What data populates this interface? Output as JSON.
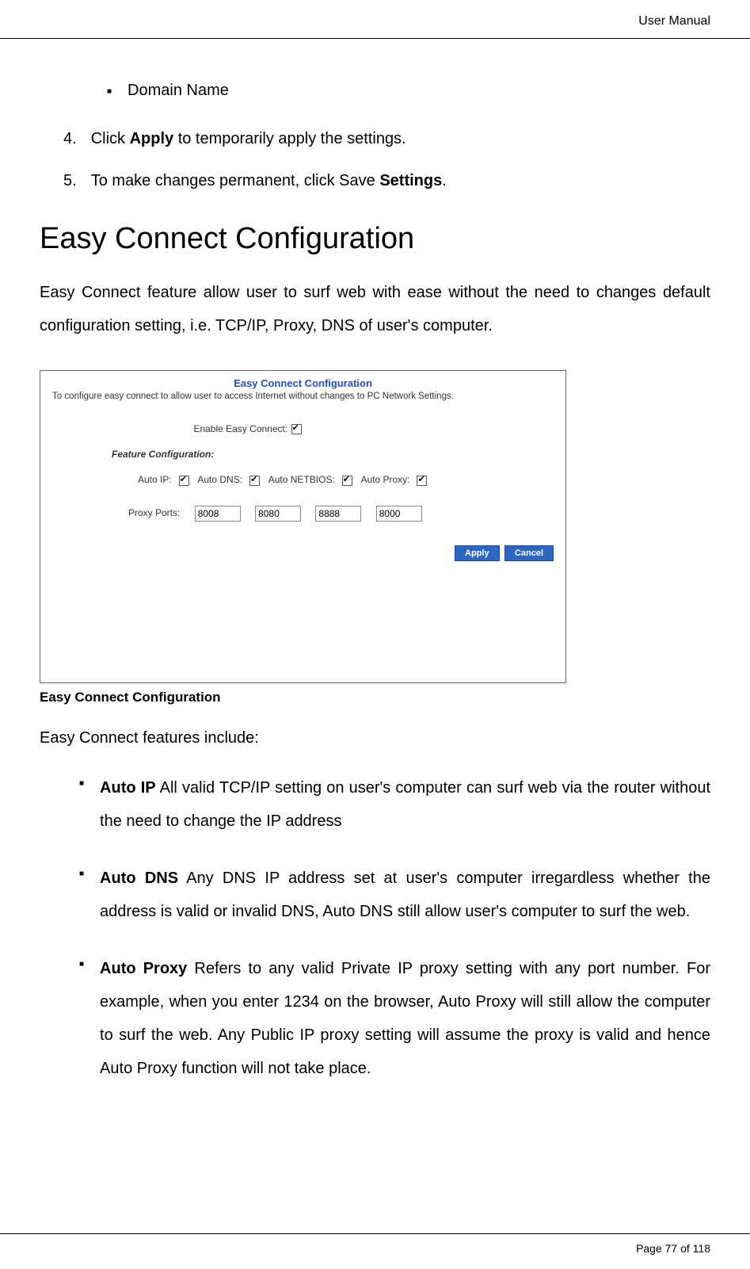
{
  "header": {
    "title": "User Manual"
  },
  "bullet1": {
    "text": "Domain Name"
  },
  "step4": {
    "num": "4.",
    "prefix": "Click ",
    "bold": "Apply",
    "suffix": " to temporarily apply the settings."
  },
  "step5": {
    "num": "5.",
    "prefix": "To make changes permanent, click Save ",
    "bold": "Settings",
    "suffix": "."
  },
  "mainHeading": "Easy Connect Configuration",
  "para1": "Easy Connect feature allow user to surf web with ease without the need to changes default configuration setting, i.e. TCP/IP, Proxy, DNS of user's computer.",
  "screenshot": {
    "title": "Easy Connect Configuration",
    "desc": "To configure easy connect to allow user to access Internet without changes to PC Network Settings.",
    "enableLabel": "Enable Easy Connect:",
    "featureConfigLabel": "Feature Configuration:",
    "autoIp": "Auto IP:",
    "autoDns": "Auto DNS:",
    "autoNetbios": "Auto NETBIOS:",
    "autoProxy": "Auto Proxy:",
    "proxyPortsLabel": "Proxy Ports:",
    "port1": "8008",
    "port2": "8080",
    "port3": "8888",
    "port4": "8000",
    "applyBtn": "Apply",
    "cancelBtn": "Cancel"
  },
  "screenshotCaption": "Easy Connect Configuration",
  "featuresIntro": "Easy Connect features include:",
  "feature1": {
    "bold": "Auto IP",
    "text": " All valid TCP/IP setting on user's computer can surf web via the router without the need to change the IP address"
  },
  "feature2": {
    "bold": "Auto DNS",
    "text": " Any DNS IP address set at user's computer irregardless whether the address is valid or invalid DNS, Auto DNS still allow user's computer to surf the web."
  },
  "feature3": {
    "bold": "Auto Proxy",
    "text": " Refers to any valid Private IP proxy setting with any port number. For example, when you enter 1234 on the browser, Auto Proxy will still allow the computer to surf the web. Any Public IP proxy setting will assume the proxy is valid and hence Auto Proxy function will not take place."
  },
  "footer": {
    "text": "Page 77 of 118"
  }
}
